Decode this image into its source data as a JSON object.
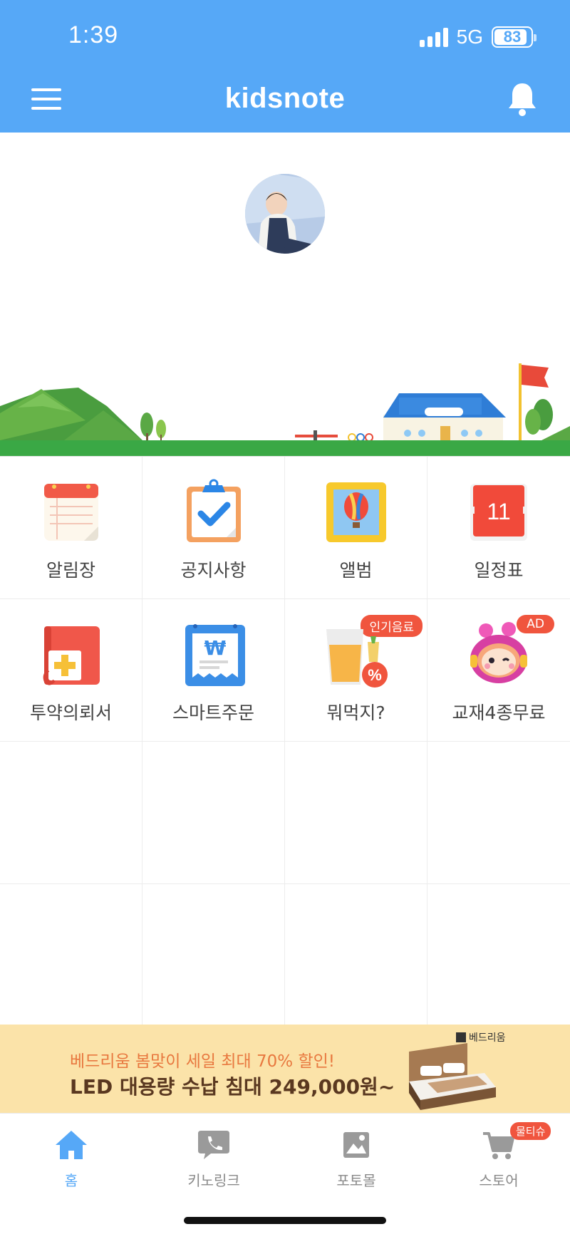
{
  "status_bar": {
    "time": "1:39",
    "network": "5G",
    "battery": "83",
    "battery_level": 0.83
  },
  "header": {
    "logo": "kidsnote",
    "menu_icon": "hamburger-menu-icon",
    "notification_icon": "bell-icon"
  },
  "profile": {
    "name": "",
    "subtitle": ""
  },
  "grid": [
    {
      "label": "알림장",
      "icon": "notebook-icon"
    },
    {
      "label": "공지사항",
      "icon": "clipboard-check-icon"
    },
    {
      "label": "앨범",
      "icon": "album-balloon-icon"
    },
    {
      "label": "일정표",
      "icon": "calendar-icon",
      "icon_text": "11"
    },
    {
      "label": "투약의뢰서",
      "icon": "medicine-request-icon"
    },
    {
      "label": "스마트주문",
      "icon": "smart-order-icon"
    },
    {
      "label": "뭐먹지?",
      "icon": "drink-icon",
      "badge": "인기음료"
    },
    {
      "label": "교재4종무료",
      "icon": "character-icon",
      "badge": "AD"
    }
  ],
  "banner": {
    "line1": "베드리움 봄맞이 세일 최대 70% 할인!",
    "line2": "LED 대용량 수납 침대 249,000원~",
    "brand": "베드리움"
  },
  "tabs": [
    {
      "label": "홈",
      "icon": "home-icon",
      "active": true
    },
    {
      "label": "키노링크",
      "icon": "phone-chat-icon",
      "active": false
    },
    {
      "label": "포토몰",
      "icon": "photo-icon",
      "active": false
    },
    {
      "label": "스토어",
      "icon": "cart-icon",
      "active": false,
      "badge": "물티슈"
    }
  ],
  "colors": {
    "primary": "#56a8f7",
    "badge": "#f0553e",
    "banner_bg": "#fbe3a9",
    "grass": "#3aa845"
  }
}
